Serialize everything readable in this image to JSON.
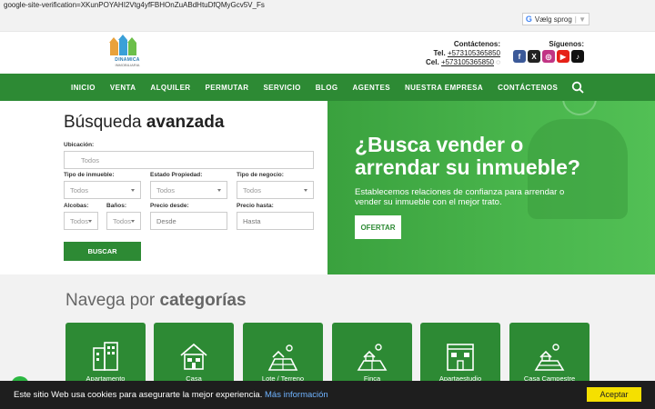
{
  "verification": "google-site-verification=XKunPOYAHI2Vtg4yfFBHOnZuABdHtuDfQMyGcv5V_Fs",
  "translate": {
    "label": "Vælg sprog",
    "icon": "google-g-icon"
  },
  "header": {
    "logo_text": "DINAMICA",
    "logo_sub": "INMOBILIARIA",
    "contact_title": "Contáctenos:",
    "tel_label": "Tel.",
    "tel": "+573105365850",
    "cel_label": "Cel.",
    "cel": "+573105365850",
    "follow_label": "Síguenos:",
    "social": [
      {
        "icon": "facebook-icon",
        "glyph": "f",
        "color": "#3b5998"
      },
      {
        "icon": "x-twitter-icon",
        "glyph": "X",
        "color": "#222222"
      },
      {
        "icon": "instagram-icon",
        "glyph": "◎",
        "color": "#c13584"
      },
      {
        "icon": "youtube-icon",
        "glyph": "▶",
        "color": "#e62117"
      },
      {
        "icon": "tiktok-icon",
        "glyph": "♪",
        "color": "#111111"
      }
    ]
  },
  "nav": {
    "items": [
      "INICIO",
      "VENTA",
      "ALQUILER",
      "PERMUTAR",
      "SERVICIO",
      "BLOG",
      "AGENTES",
      "NUESTRA EMPRESA",
      "CONTÁCTENOS"
    ]
  },
  "search": {
    "title_light": "Búsqueda",
    "title_bold": "avanzada",
    "location_label": "Ubicación:",
    "location_placeholder": "Todos",
    "tipo_inmueble_label": "Tipo de inmueble:",
    "tipo_inmueble_value": "Todos",
    "estado_label": "Estado Propiedad:",
    "estado_value": "Todos",
    "negocio_label": "Tipo de negocio:",
    "negocio_value": "Todos",
    "alcobas_label": "Alcobas:",
    "alcobas_value": "Todos",
    "banos_label": "Baños:",
    "banos_value": "Todos",
    "precio_desde_label": "Precio desde:",
    "precio_desde_placeholder": "Desde",
    "precio_hasta_label": "Precio hasta:",
    "precio_hasta_placeholder": "Hasta",
    "button": "BUSCAR"
  },
  "hero": {
    "title_line1": "¿Busca vender o",
    "title_line2": "arrendar su inmueble?",
    "text": "Establecemos relaciones de confianza para arrendar o vender su inmueble con el mejor trato.",
    "button": "OFERTAR"
  },
  "categories": {
    "title_light": "Navega por",
    "title_bold": "categorías",
    "items": [
      {
        "label": "Apartamento",
        "icon": "apartment-building-icon"
      },
      {
        "label": "Casa",
        "icon": "house-icon"
      },
      {
        "label": "Lote / Terreno",
        "icon": "land-lot-icon"
      },
      {
        "label": "Finca",
        "icon": "farm-icon"
      },
      {
        "label": "Apartaestudio",
        "icon": "studio-building-icon"
      },
      {
        "label": "Casa Campestre",
        "icon": "country-house-icon"
      }
    ]
  },
  "cookie": {
    "message": "Este sitio Web usa cookies para asegurarte la mejor experiencia.",
    "more": "Más información",
    "accept": "Aceptar"
  }
}
